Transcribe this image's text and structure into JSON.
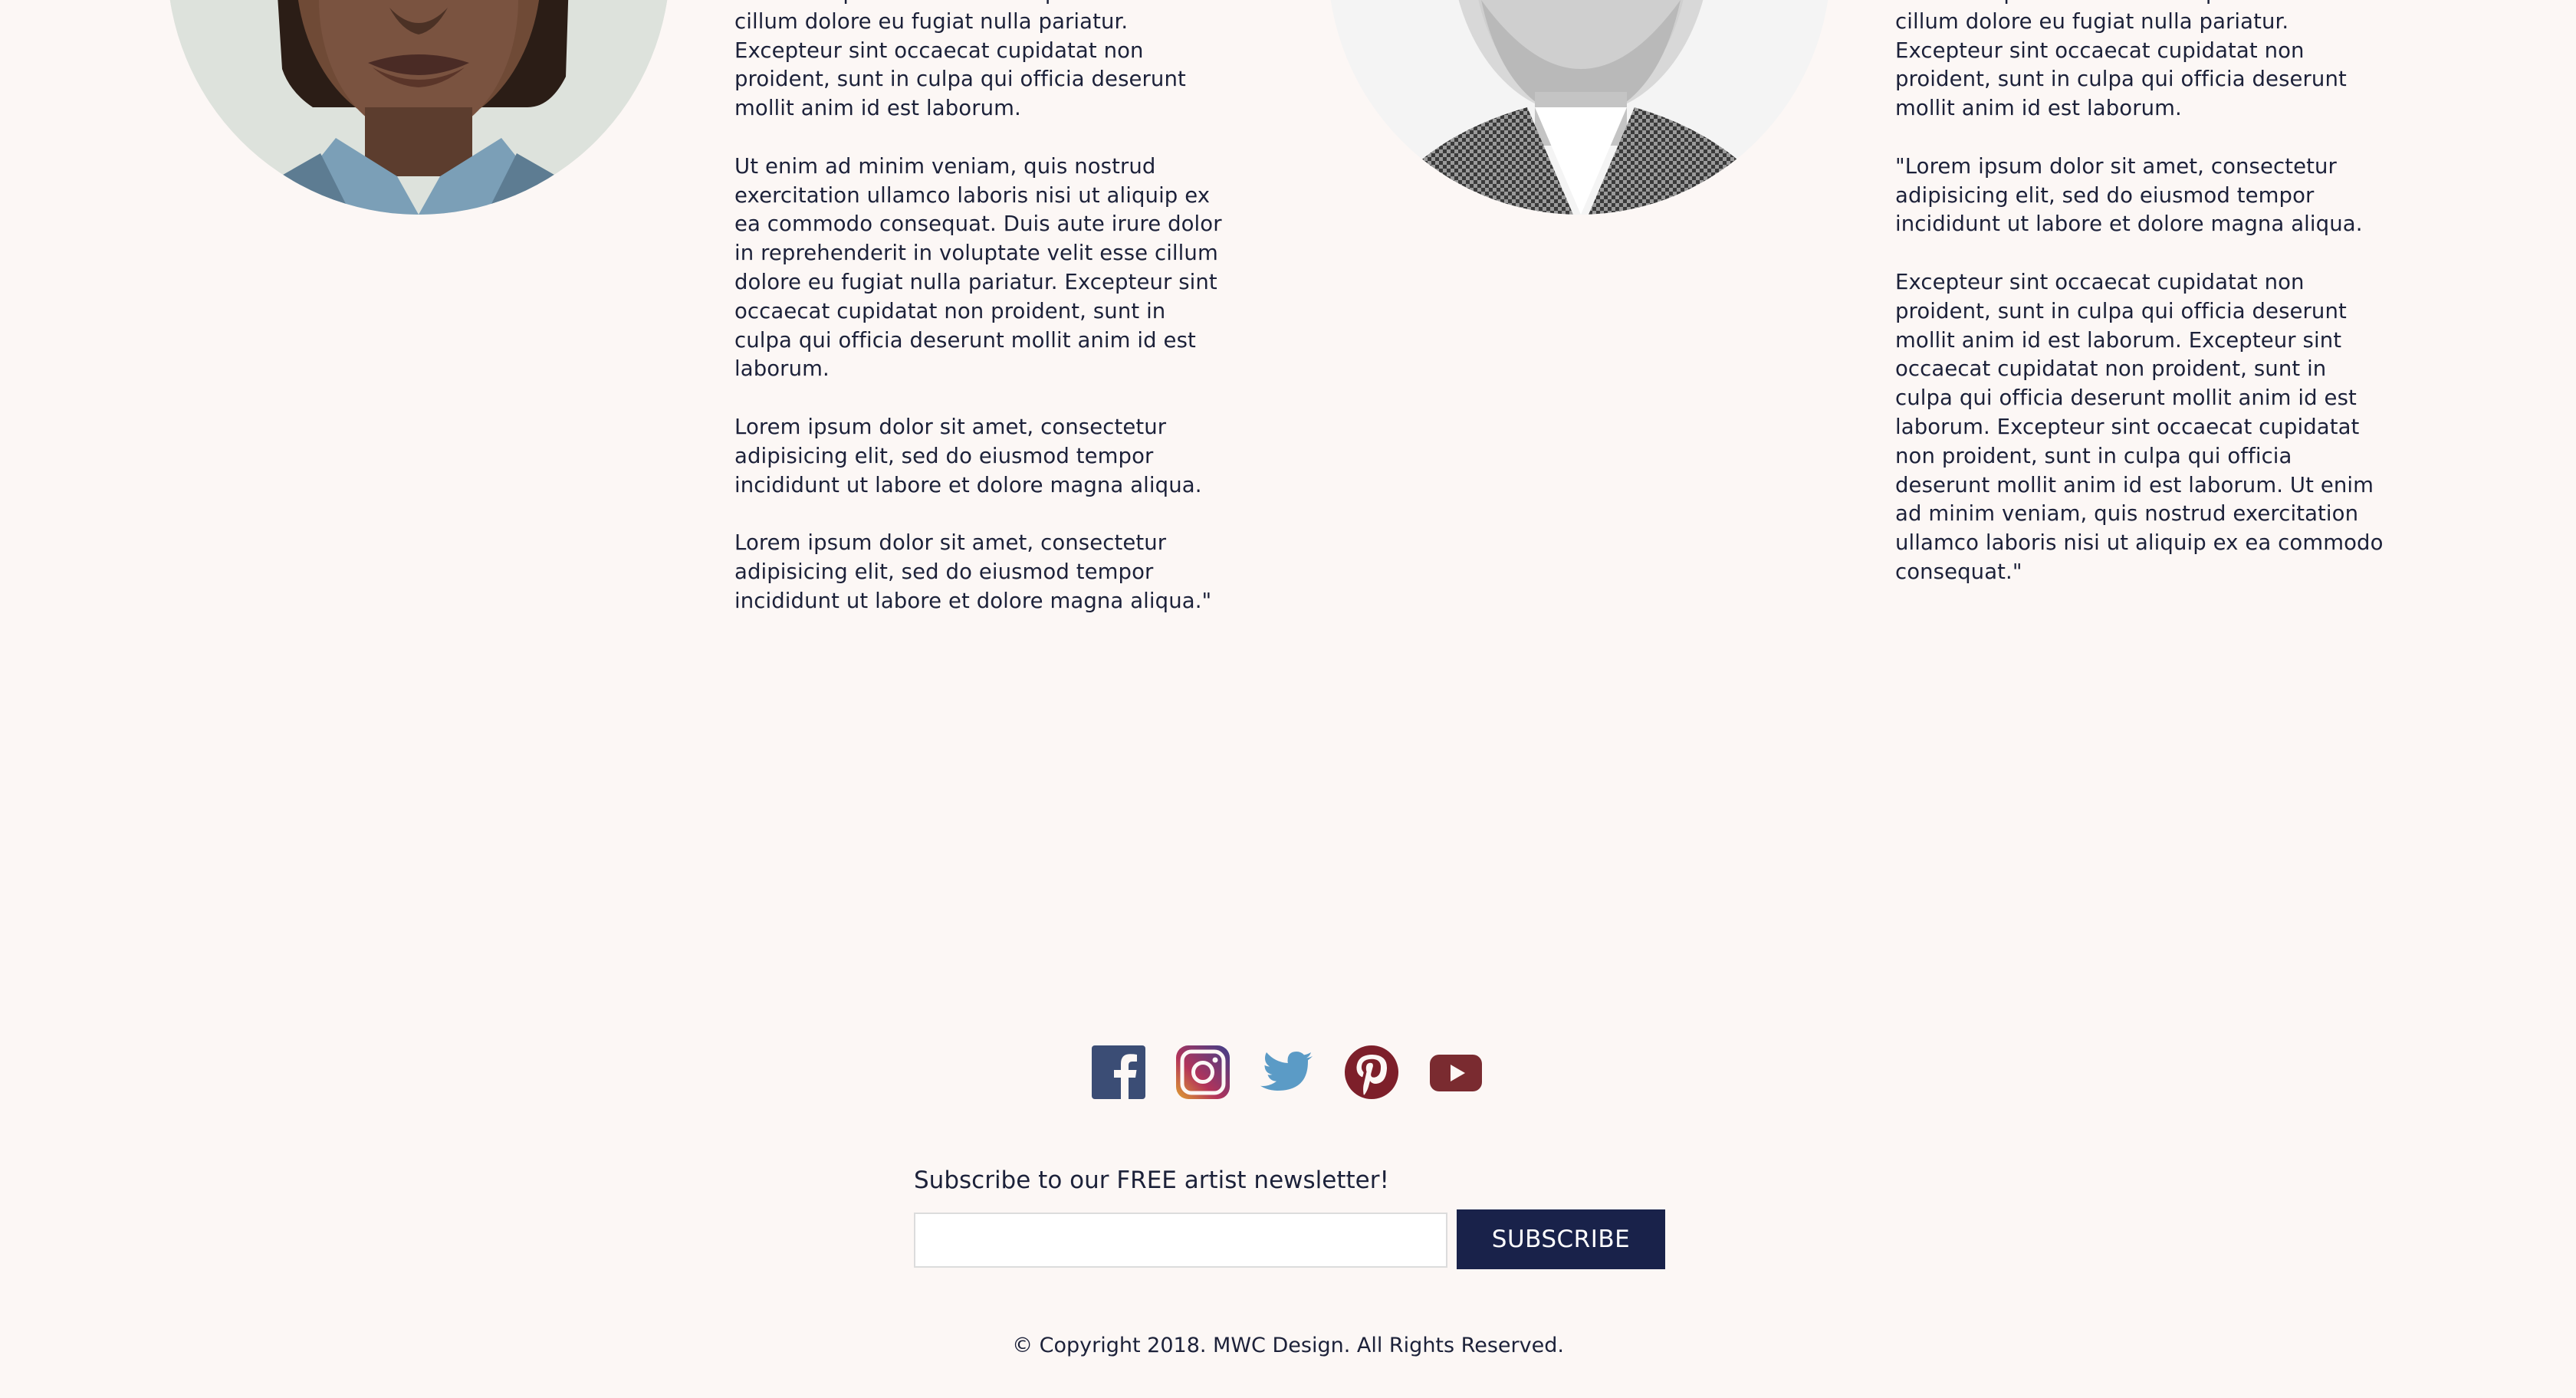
{
  "bios": {
    "left": {
      "paragraphs": [
        "dolor in reprehenderit in voluptate velit esse cillum dolore eu fugiat nulla pariatur. Excepteur sint occaecat cupidatat non proident, sunt in culpa qui officia deserunt mollit anim id est laborum.",
        "Ut enim ad minim veniam, quis nostrud exercitation ullamco laboris nisi ut aliquip ex ea commodo consequat. Duis aute irure dolor in reprehenderit in voluptate velit esse cillum dolore eu fugiat nulla pariatur. Excepteur sint occaecat cupidatat non proident, sunt in culpa qui officia deserunt mollit anim id est laborum.",
        "Lorem ipsum dolor sit amet, consectetur adipisicing elit, sed do eiusmod tempor incididunt ut labore et dolore magna aliqua.",
        "Lorem ipsum dolor sit amet, consectetur adipisicing elit, sed do eiusmod tempor incididunt ut labore et dolore magna aliqua.\""
      ]
    },
    "right": {
      "paragraphs": [
        "dolor in reprehenderit in voluptate velit esse cillum dolore eu fugiat nulla pariatur. Excepteur sint occaecat cupidatat non proident, sunt in culpa qui officia deserunt mollit anim id est laborum.",
        "\"Lorem ipsum dolor sit amet, consectetur adipisicing elit, sed do eiusmod tempor incididunt ut labore et dolore magna aliqua.",
        "Excepteur sint occaecat cupidatat non proident, sunt in culpa qui officia deserunt mollit anim id est laborum. Excepteur sint occaecat cupidatat non proident, sunt in culpa qui officia deserunt mollit anim id est laborum. Excepteur sint occaecat cupidatat non proident, sunt in culpa qui officia deserunt mollit anim id est laborum. Ut enim ad minim veniam, quis nostrud exercitation ullamco laboris nisi ut aliquip ex ea commodo consequat.\""
      ]
    }
  },
  "social": {
    "icons": [
      "facebook-icon",
      "instagram-icon",
      "twitter-icon",
      "pinterest-icon",
      "youtube-icon"
    ],
    "colors": {
      "facebook": "#3b4d75",
      "instagram": "#8a3e6b",
      "twitter": "#5b9bc6",
      "pinterest": "#7d1f2a",
      "youtube": "#7a2b30"
    }
  },
  "newsletter": {
    "title": "Subscribe to our FREE artist newsletter!",
    "input_value": "",
    "button_label": "SUBSCRIBE",
    "button_color": "#19224a"
  },
  "footer": {
    "copyright": "© Copyright 2018. MWC Design. All Rights Reserved."
  }
}
